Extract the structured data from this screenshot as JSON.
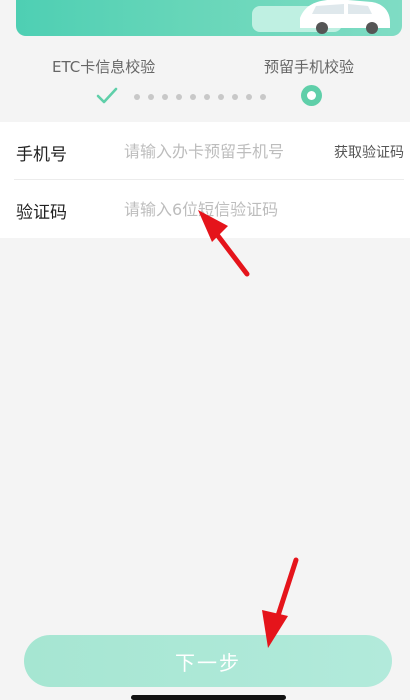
{
  "steps": {
    "step1_label": "ETC卡信息校验",
    "step2_label": "预留手机校验",
    "dot_count": 10
  },
  "form": {
    "phone": {
      "label": "手机号",
      "placeholder": "请输入办卡预留手机号",
      "value": "",
      "get_code_label": "获取验证码"
    },
    "code": {
      "label": "验证码",
      "placeholder": "请输入6位短信验证码",
      "value": ""
    }
  },
  "next_button_label": "下一步",
  "colors": {
    "accent": "#5fcfa9",
    "button": "#a6e6d2",
    "annotation_arrow": "#e5141b"
  },
  "icons": [
    "check-icon",
    "car-icon",
    "step-current-icon",
    "annotation-arrow"
  ]
}
